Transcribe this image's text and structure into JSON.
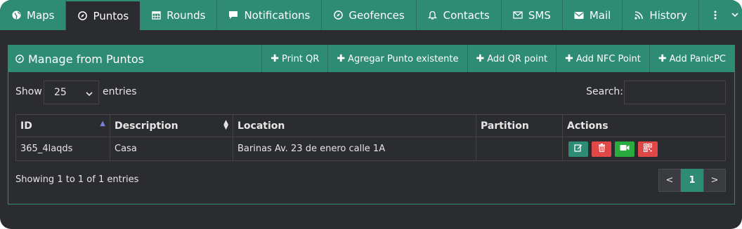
{
  "tabs": [
    {
      "label": "Maps",
      "icon": "globe-icon"
    },
    {
      "label": "Puntos",
      "icon": "compass-icon"
    },
    {
      "label": "Rounds",
      "icon": "calendar-icon"
    },
    {
      "label": "Notifications",
      "icon": "comment-icon"
    },
    {
      "label": "Geofences",
      "icon": "compass-icon"
    },
    {
      "label": "Contacts",
      "icon": "bell-icon"
    },
    {
      "label": "SMS",
      "icon": "envelope-open-icon"
    },
    {
      "label": "Mail",
      "icon": "envelope-icon"
    },
    {
      "label": "History",
      "icon": "rss-icon"
    }
  ],
  "active_tab": "Puntos",
  "panel": {
    "title": "Manage from Puntos",
    "buttons": [
      "Print QR",
      "Agregar Punto existente",
      "Add QR point",
      "Add NFC Point",
      "Add PanicPC"
    ]
  },
  "controls": {
    "show_label": "Show",
    "entries_value": "25",
    "entries_label": "entries",
    "search_label": "Search:",
    "search_value": ""
  },
  "table": {
    "columns": [
      "ID",
      "Description",
      "Location",
      "Partition",
      "Actions"
    ],
    "rows": [
      {
        "id": "365_4laqds",
        "description": "Casa",
        "location": "Barinas Av. 23 de enero calle 1A",
        "partition": ""
      }
    ]
  },
  "footer": {
    "showing": "Showing 1 to 1 of 1 entries",
    "prev": "<",
    "page": "1",
    "next": ">"
  },
  "colors": {
    "accent": "#2e8b74",
    "background": "#2b2c30",
    "danger": "#e04848",
    "success": "#2aab3f"
  }
}
